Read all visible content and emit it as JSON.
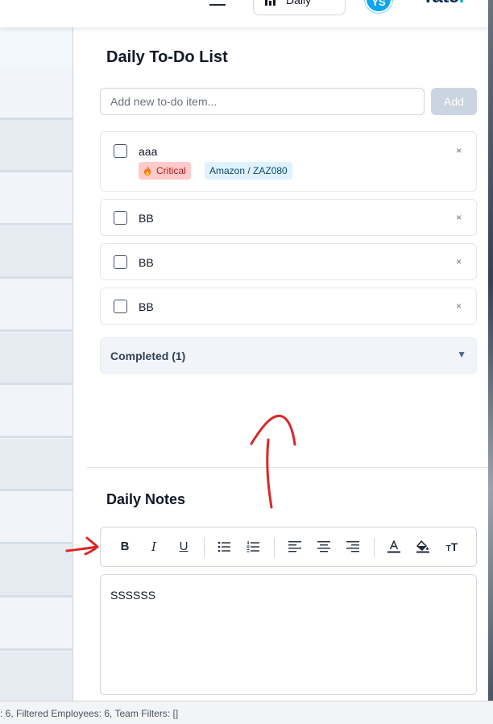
{
  "header": {
    "period_label": "Daily",
    "avatar_initials": "YS",
    "brand_text": "Tate",
    "brand_suffix": "."
  },
  "todo": {
    "title": "Daily To-Do List",
    "input_placeholder": "Add new to-do item...",
    "add_label": "Add",
    "remove_symbol": "×",
    "items": [
      {
        "text": "aaa",
        "priority": "Critical",
        "project": "Amazon / ZAZ080"
      },
      {
        "text": "BB"
      },
      {
        "text": "BB"
      },
      {
        "text": "BB"
      }
    ],
    "completed_label": "Completed (1)",
    "completed_caret": "▼"
  },
  "notes": {
    "title": "Daily Notes",
    "toolbar": {
      "bold": "B",
      "italic": "I",
      "underline": "U",
      "text_size": "T"
    },
    "content": "SSSSSS"
  },
  "status_bar": {
    "text": ": 6, Filtered Employees: 6, Team Filters: []"
  },
  "colors": {
    "annotation": "#dc2626",
    "priority_bg": "#fecaca",
    "project_bg": "#e0f2fe",
    "add_button_bg": "#cbd5e1",
    "brand": "#0b2a57",
    "accent": "#0ea5e9"
  }
}
